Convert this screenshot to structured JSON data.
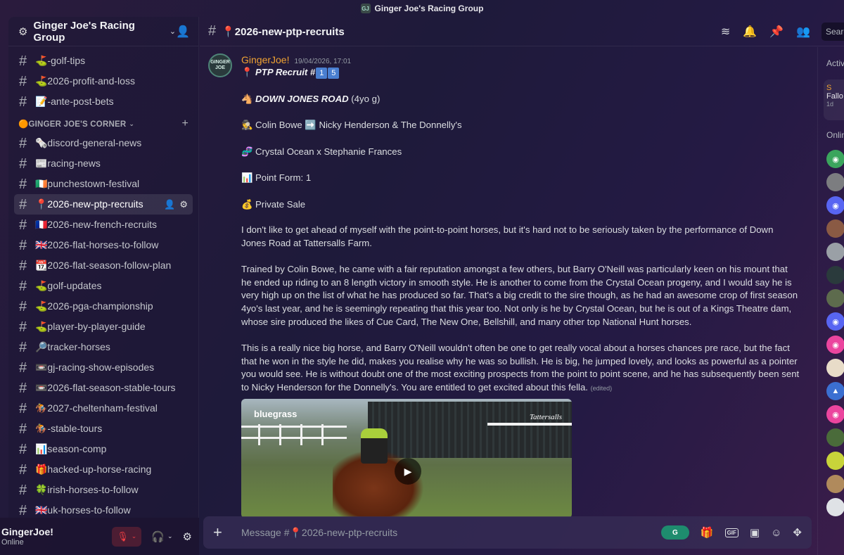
{
  "window": {
    "title": "Ginger Joe's Racing Group"
  },
  "server": {
    "name": "Ginger Joe's Racing Group"
  },
  "channels_top": [
    {
      "label": "⛳-golf-tips"
    },
    {
      "label": "⛳2026-profit-and-loss"
    },
    {
      "label": "📝-ante-post-bets"
    }
  ],
  "category": {
    "label": "🟠GINGER JOE'S CORNER"
  },
  "channels": [
    {
      "label": "🗞️discord-general-news"
    },
    {
      "label": "📰racing-news"
    },
    {
      "label": "🇮🇪punchestown-festival"
    },
    {
      "label": "📍2026-new-ptp-recruits"
    },
    {
      "label": "🇫🇷2026-new-french-recruits"
    },
    {
      "label": "🇬🇧2026-flat-horses-to-follow"
    },
    {
      "label": "📆2026-flat-season-follow-plan"
    },
    {
      "label": "⛳golf-updates"
    },
    {
      "label": "⛳2026-pga-championship"
    },
    {
      "label": "⛳player-by-player-guide"
    },
    {
      "label": "🔎tracker-horses"
    },
    {
      "label": "📼gj-racing-show-episodes"
    },
    {
      "label": "📼2026-flat-season-stable-tours"
    },
    {
      "label": "🏇2027-cheltenham-festival"
    },
    {
      "label": "🏇-stable-tours"
    },
    {
      "label": "📊season-comp"
    },
    {
      "label": "🎁hacked-up-horse-racing"
    },
    {
      "label": "🍀irish-horses-to-follow"
    },
    {
      "label": "🇬🇧uk-horses-to-follow"
    }
  ],
  "user": {
    "name": "GingerJoe!",
    "status": "Online"
  },
  "channel_header": {
    "title": "📍2026-new-ptp-recruits",
    "search_placeholder": "Search"
  },
  "message": {
    "avatar_text": "GINGER JOE",
    "author": "GingerJoe!",
    "timestamp": "19/04/2026, 17:01",
    "recruit_title": "PTP Recruit #",
    "recruit_num1": "1",
    "recruit_num2": "5",
    "horse_name": "DOWN JONES ROAD",
    "horse_age": " (4yo g)",
    "trainers": "Colin Bowe ➡️ Nicky Henderson & The Donnelly's",
    "breeding": "Crystal Ocean x Stephanie Frances",
    "point_form": "Point Form: 1",
    "sale": "Private Sale",
    "para1": "I don't like to get ahead of myself with the point-to-point horses, but it's hard not to be seriously taken by the performance of Down Jones Road at Tattersalls Farm.",
    "para2": "Trained by Colin Bowe, he came with a fair reputation amongst a few others, but Barry O'Neill was particularly keen on his mount that he ended up riding to an 8 length victory in smooth style. He is another to come from the Crystal Ocean progeny, and I would say he is very high up on the list of what he has produced so far. That's a big credit to the sire though, as he had an awesome crop of first season 4yo's last year, and he is seemingly repeating that this year too. Not only is he by Crystal Ocean, but he is out of a Kings Theatre dam, whose sire produced the likes of Cue Card, The New One, Bellshill, and many other top National Hunt horses.",
    "para3": "This is a really nice big horse, and Barry O'Neill wouldn't often be one to get really vocal about a horses chances pre race, but the fact that he won in the style he did, makes you realise why he was so bullish. He is big, he jumped lovely, and looks as powerful as a pointer you would see. He is without doubt one of the most exciting prospects from the point to point scene, and he has subsequently been sent to Nicky Henderson for the Donnelly's. You are entitled to get excited about this fella.",
    "edited": "(edited)",
    "video_logo_left": "bluegrass",
    "video_logo_right": "Tattersalls"
  },
  "composer": {
    "placeholder": "Message #📍2026-new-ptp-recruits",
    "gif_label": "GIF"
  },
  "members": {
    "active_label": "Active",
    "activity_name": "S",
    "activity_sub": "Fallo",
    "activity_time": "1d",
    "online_label": "Online"
  },
  "colors": {
    "accent": "#5865f2",
    "author": "#f0a232",
    "mute": "#f23f43"
  }
}
